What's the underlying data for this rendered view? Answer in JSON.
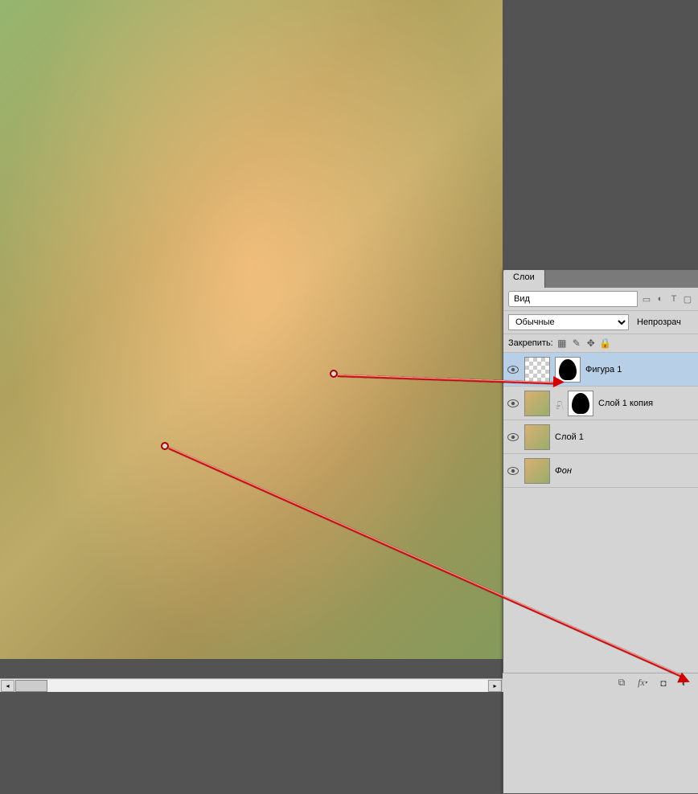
{
  "panel": {
    "tab_label": "Слои",
    "search_placeholder": "Вид",
    "blend_mode": "Обычные",
    "opacity_label": "Непрозрач",
    "lock_label": "Закрепить:"
  },
  "filter_icons": [
    "image-icon",
    "adjust-icon",
    "text-icon",
    "shape-icon"
  ],
  "layers": [
    {
      "name": "Фигура 1",
      "visible": true,
      "selected": true,
      "thumb": "checker",
      "mask": true,
      "italic": false
    },
    {
      "name": "Слой 1 копия",
      "visible": true,
      "selected": false,
      "thumb": "photo",
      "mask": true,
      "linked": true,
      "italic": false
    },
    {
      "name": "Слой 1",
      "visible": true,
      "selected": false,
      "thumb": "photo",
      "mask": false,
      "italic": false
    },
    {
      "name": "Фон",
      "visible": true,
      "selected": false,
      "thumb": "photo",
      "mask": false,
      "italic": true
    }
  ],
  "bottom_icons": [
    "link-layers-icon",
    "fx-icon",
    "mask-icon",
    "adjustment-icon"
  ]
}
